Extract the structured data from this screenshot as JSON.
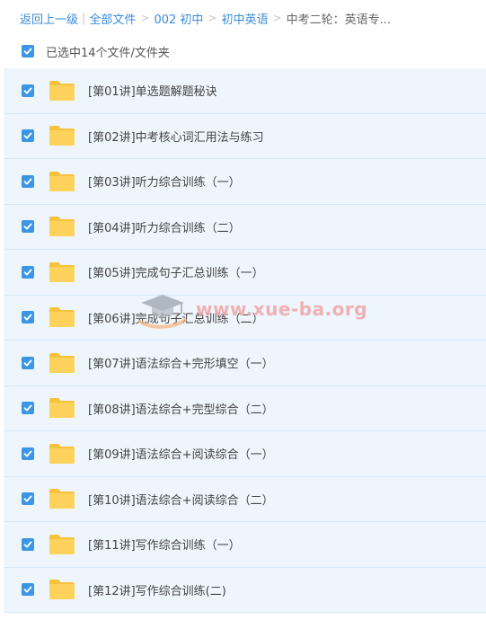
{
  "breadcrumb": {
    "back": "返回上一级",
    "items": [
      "全部文件",
      "002 初中",
      "初中英语"
    ],
    "current": "中考二轮：英语专..."
  },
  "selection": {
    "label": "已选中14个文件/文件夹",
    "checked": true
  },
  "files": [
    "[第01讲]单选题解题秘诀",
    "[第02讲]中考核心词汇用法与练习",
    "[第03讲]听力综合训练（一）",
    "[第04讲]听力综合训练（二）",
    "[第05讲]完成句子汇总训练（一）",
    "[第06讲]完成句子汇总训练（二）",
    "[第07讲]语法综合+完形填空（一）",
    "[第08讲]语法综合+完型综合（二）",
    "[第09讲]语法综合+阅读综合（一）",
    "[第10讲]语法综合+阅读综合（二）",
    "[第11讲]写作综合训练（一）",
    "[第12讲]写作综合训练(二)"
  ],
  "watermark": {
    "text": "www.xue-ba.org",
    "icon": "graduation-cap-icon"
  },
  "colors": {
    "accent": "#3b96e6",
    "link": "#3b8cd9",
    "row_bg": "#eef5fc",
    "folder": "#ffd35b"
  }
}
